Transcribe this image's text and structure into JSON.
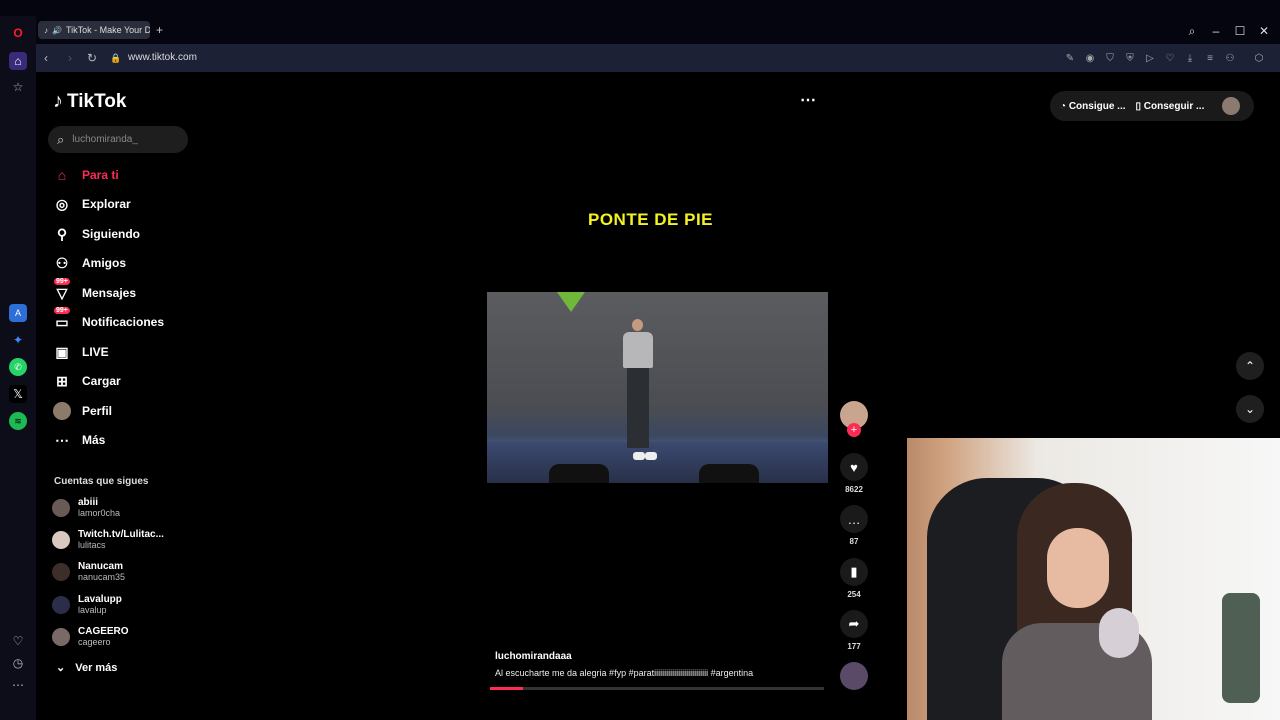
{
  "browser": {
    "tab_title": "TikTok - Make Your Da",
    "url": "www.tiktok.com"
  },
  "tiktok": {
    "logo": "TikTok",
    "search_placeholder": "luchomiranda_",
    "nav": [
      {
        "label": "Para ti",
        "icon": "home-icon",
        "active": true
      },
      {
        "label": "Explorar",
        "icon": "compass-icon"
      },
      {
        "label": "Siguiendo",
        "icon": "following-icon"
      },
      {
        "label": "Amigos",
        "icon": "friends-icon"
      },
      {
        "label": "Mensajes",
        "icon": "messages-icon",
        "badge": "99+"
      },
      {
        "label": "Notificaciones",
        "icon": "inbox-icon",
        "badge": "99+"
      },
      {
        "label": "LIVE",
        "icon": "live-icon"
      },
      {
        "label": "Cargar",
        "icon": "upload-icon"
      },
      {
        "label": "Perfil",
        "icon": "profile-avatar"
      },
      {
        "label": "Más",
        "icon": "more-icon"
      }
    ],
    "following_title": "Cuentas que sigues",
    "accounts": [
      {
        "name": "abiii",
        "user": "lamor0cha"
      },
      {
        "name": "Twitch.tv/Lulitac...",
        "user": "lulitacs"
      },
      {
        "name": "Nanucam",
        "user": "nanucam35"
      },
      {
        "name": "Lavalupp",
        "user": "lavalup"
      },
      {
        "name": "CAGEERO",
        "user": "cageero"
      }
    ],
    "see_more": "Ver más",
    "top_buttons": [
      "Consigue ...",
      "Conseguir ..."
    ],
    "video": {
      "overlay_text": "PONTE DE PIE",
      "author": "luchomirandaaa",
      "caption": "Al escucharte me da alegria #fyp  #paratiiiiiiiiiiiiiiiiiiiiiiiiiii  #argentina",
      "progress": 0.1,
      "likes": "8622",
      "comments": "87",
      "saves": "254",
      "shares": "177"
    }
  },
  "colors": {
    "accent": "#fe2c55",
    "overlay_yellow": "#f4f320"
  }
}
